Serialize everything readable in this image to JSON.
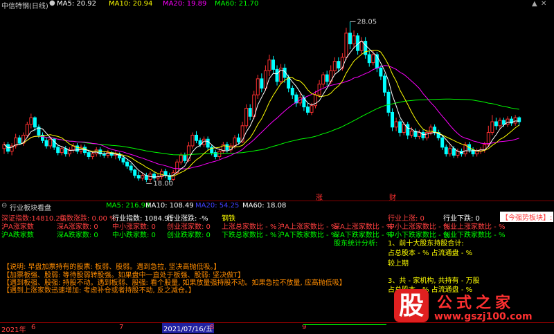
{
  "top": {
    "title": "中信特钢(日线)",
    "ma_items": [
      {
        "label": "MA5: 20.92",
        "color": "#ffffff"
      },
      {
        "label": "MA10: 20.94",
        "color": "#ffff00"
      },
      {
        "label": "MA20: 19.89",
        "color": "#ff00ff"
      },
      {
        "label": "MA60: 21.70",
        "color": "#00ff00"
      }
    ]
  },
  "chart_data": {
    "type": "candlestick",
    "high_label": "28.05",
    "low_label": "18.00",
    "markers": [
      {
        "text": "涨",
        "color": "#ff3030"
      },
      {
        "text": "财",
        "color": "#ff3030"
      }
    ],
    "candles": [
      [
        18.6,
        18.9,
        18.2,
        19.1
      ],
      [
        18.9,
        18.4,
        18.2,
        19.1
      ],
      [
        18.4,
        18.8,
        18.1,
        19.0
      ],
      [
        18.8,
        19.4,
        18.6,
        19.7
      ],
      [
        19.4,
        19.0,
        18.9,
        19.6
      ],
      [
        19.0,
        19.6,
        18.8,
        19.8
      ],
      [
        19.6,
        20.4,
        19.4,
        20.6
      ],
      [
        20.4,
        20.9,
        20.1,
        21.2
      ],
      [
        20.9,
        20.2,
        19.9,
        21.0
      ],
      [
        20.2,
        19.6,
        19.4,
        20.4
      ],
      [
        19.6,
        19.2,
        19.0,
        19.8
      ],
      [
        19.2,
        18.8,
        18.6,
        19.4
      ],
      [
        18.8,
        19.3,
        18.6,
        19.5
      ],
      [
        19.3,
        18.7,
        18.5,
        19.4
      ],
      [
        18.7,
        18.3,
        18.1,
        18.9
      ],
      [
        18.3,
        18.6,
        18.1,
        18.8
      ],
      [
        18.6,
        18.2,
        18.0,
        18.8
      ],
      [
        18.2,
        18.5,
        18.0,
        18.7
      ],
      [
        18.5,
        18.8,
        18.3,
        19.0
      ],
      [
        18.8,
        18.4,
        18.2,
        19.0
      ],
      [
        18.4,
        18.7,
        18.2,
        18.9
      ],
      [
        18.7,
        18.3,
        18.1,
        18.9
      ],
      [
        18.3,
        18.0,
        17.8,
        18.5
      ],
      [
        18.0,
        18.2,
        17.8,
        18.4
      ],
      [
        18.2,
        18.5,
        18.0,
        18.7
      ],
      [
        18.5,
        18.2,
        18.0,
        18.7
      ],
      [
        18.2,
        18.1,
        17.9,
        18.4
      ],
      [
        18.1,
        18.3,
        17.9,
        18.5
      ],
      [
        18.3,
        18.1,
        17.9,
        18.4
      ],
      [
        18.1,
        18.2,
        17.8,
        18.4
      ],
      [
        18.2,
        17.9,
        17.7,
        18.3
      ],
      [
        17.9,
        17.6,
        17.4,
        18.1
      ],
      [
        17.6,
        17.3,
        17.1,
        17.8
      ],
      [
        17.3,
        17.0,
        16.8,
        17.5
      ],
      [
        17.0,
        16.6,
        16.4,
        17.1
      ],
      [
        16.6,
        16.4,
        16.2,
        16.9
      ],
      [
        16.4,
        16.6,
        16.2,
        16.8
      ],
      [
        16.6,
        16.3,
        16.1,
        16.8
      ],
      [
        16.3,
        16.7,
        16.1,
        16.9
      ],
      [
        16.7,
        16.4,
        16.2,
        16.9
      ],
      [
        16.4,
        16.5,
        16.2,
        16.7
      ],
      [
        16.5,
        16.9,
        16.3,
        17.1
      ],
      [
        16.9,
        16.6,
        16.4,
        17.1
      ],
      [
        16.6,
        16.3,
        16.1,
        16.8
      ],
      [
        16.3,
        16.8,
        16.2,
        17.0
      ],
      [
        16.8,
        17.6,
        16.7,
        17.8
      ],
      [
        17.6,
        18.1,
        17.4,
        18.3
      ],
      [
        18.1,
        17.7,
        17.5,
        18.3
      ],
      [
        17.7,
        18.8,
        17.6,
        19.1
      ],
      [
        18.8,
        19.6,
        18.6,
        19.8
      ],
      [
        19.6,
        19.2,
        19.0,
        19.9
      ],
      [
        19.2,
        18.9,
        18.7,
        19.4
      ],
      [
        18.9,
        19.3,
        18.7,
        19.5
      ],
      [
        19.3,
        18.7,
        18.5,
        19.5
      ],
      [
        18.7,
        18.3,
        18.1,
        18.9
      ],
      [
        18.3,
        18.0,
        17.8,
        18.5
      ],
      [
        18.0,
        18.4,
        17.8,
        18.6
      ],
      [
        18.4,
        18.9,
        18.2,
        19.1
      ],
      [
        18.9,
        18.5,
        18.3,
        19.1
      ],
      [
        18.5,
        18.8,
        18.3,
        19.0
      ],
      [
        18.8,
        19.4,
        18.6,
        19.6
      ],
      [
        19.4,
        19.1,
        18.9,
        19.7
      ],
      [
        19.1,
        20.3,
        19.0,
        20.6
      ],
      [
        20.3,
        21.6,
        20.1,
        21.9
      ],
      [
        21.6,
        21.0,
        20.7,
        21.9
      ],
      [
        21.0,
        22.6,
        20.8,
        22.9
      ],
      [
        22.6,
        23.8,
        22.3,
        24.1
      ],
      [
        23.8,
        23.1,
        22.8,
        24.2
      ],
      [
        23.1,
        24.4,
        22.9,
        24.8
      ],
      [
        24.4,
        25.2,
        24.0,
        25.6
      ],
      [
        25.2,
        24.5,
        24.2,
        25.5
      ],
      [
        24.5,
        23.6,
        23.3,
        24.8
      ],
      [
        23.6,
        24.6,
        23.4,
        24.9
      ],
      [
        24.6,
        23.9,
        23.5,
        24.9
      ],
      [
        23.9,
        23.1,
        22.8,
        24.1
      ],
      [
        23.1,
        22.6,
        22.3,
        23.3
      ],
      [
        22.6,
        22.0,
        21.7,
        22.8
      ],
      [
        22.0,
        22.4,
        21.8,
        22.7
      ],
      [
        22.4,
        21.7,
        21.4,
        22.6
      ],
      [
        21.7,
        21.3,
        21.1,
        22.0
      ],
      [
        21.3,
        21.8,
        21.1,
        22.0
      ],
      [
        21.8,
        22.6,
        21.6,
        22.9
      ],
      [
        22.6,
        23.4,
        22.4,
        23.7
      ],
      [
        23.4,
        24.1,
        23.1,
        24.3
      ],
      [
        24.1,
        23.6,
        23.3,
        24.4
      ],
      [
        23.6,
        24.4,
        23.4,
        24.8
      ],
      [
        24.4,
        25.1,
        24.1,
        25.4
      ],
      [
        25.1,
        24.6,
        24.3,
        25.4
      ],
      [
        24.6,
        25.4,
        24.4,
        25.7
      ],
      [
        25.4,
        27.2,
        25.2,
        27.6
      ],
      [
        27.2,
        26.4,
        26.0,
        28.05
      ],
      [
        26.4,
        27.0,
        26.1,
        27.4
      ],
      [
        27.0,
        25.9,
        25.6,
        27.2
      ],
      [
        25.9,
        26.6,
        25.6,
        26.9
      ],
      [
        26.6,
        25.6,
        25.3,
        26.9
      ],
      [
        25.6,
        25.0,
        24.7,
        25.9
      ],
      [
        25.0,
        25.6,
        24.8,
        25.9
      ],
      [
        25.6,
        24.6,
        24.3,
        25.8
      ],
      [
        24.6,
        24.0,
        23.7,
        24.8
      ],
      [
        24.0,
        22.8,
        22.5,
        24.2
      ],
      [
        22.8,
        21.3,
        21.0,
        23.0
      ],
      [
        21.3,
        20.2,
        19.9,
        21.6
      ],
      [
        20.2,
        20.6,
        19.9,
        20.9
      ],
      [
        20.6,
        19.8,
        19.5,
        20.8
      ],
      [
        19.8,
        20.4,
        19.6,
        20.6
      ],
      [
        20.4,
        19.6,
        19.3,
        20.6
      ],
      [
        19.6,
        19.9,
        19.4,
        20.2
      ],
      [
        19.9,
        19.5,
        19.3,
        20.1
      ],
      [
        19.5,
        19.8,
        19.3,
        20.0
      ],
      [
        19.8,
        19.4,
        19.2,
        20.0
      ],
      [
        19.4,
        19.8,
        19.2,
        20.0
      ],
      [
        19.8,
        20.2,
        19.6,
        20.4
      ],
      [
        20.2,
        19.8,
        19.6,
        20.4
      ],
      [
        19.8,
        19.4,
        19.2,
        20.0
      ],
      [
        19.4,
        18.7,
        18.5,
        19.6
      ],
      [
        18.7,
        18.2,
        18.0,
        18.9
      ],
      [
        18.2,
        18.6,
        18.0,
        18.9
      ],
      [
        18.6,
        18.1,
        17.9,
        18.8
      ],
      [
        18.1,
        18.4,
        17.9,
        18.6
      ],
      [
        18.4,
        18.2,
        18.0,
        18.6
      ],
      [
        18.2,
        18.9,
        18.0,
        19.1
      ],
      [
        18.9,
        18.5,
        18.3,
        19.1
      ],
      [
        18.5,
        18.2,
        18.0,
        18.7
      ],
      [
        18.2,
        18.4,
        18.0,
        18.6
      ],
      [
        18.4,
        18.5,
        18.2,
        18.7
      ],
      [
        18.5,
        18.9,
        18.3,
        19.1
      ],
      [
        18.9,
        19.8,
        18.7,
        20.3
      ],
      [
        19.8,
        20.6,
        19.6,
        21.1
      ],
      [
        20.6,
        20.3,
        20.0,
        20.9
      ],
      [
        20.3,
        20.7,
        20.1,
        20.9
      ],
      [
        20.7,
        20.4,
        20.2,
        20.9
      ],
      [
        20.4,
        20.8,
        20.2,
        21.0
      ],
      [
        20.8,
        20.5,
        20.3,
        21.0
      ],
      [
        20.5,
        20.9,
        20.3,
        21.1
      ],
      [
        20.9,
        20.6,
        20.3,
        21.0
      ]
    ],
    "ma5_color": "#ffffff",
    "ma10_color": "#ffff00",
    "ma20_color": "#ff00ff",
    "ma60_color": "#00ff00",
    "up_color": "#ff3030",
    "down_color": "#00ffff"
  },
  "sub": {
    "title": "行业板块看盘",
    "ma_items": [
      {
        "label": "MA5: 216.98",
        "color": "#00ff00"
      },
      {
        "label": "MA10: 108.49",
        "color": "#ffffff"
      },
      {
        "label": "MA20: 54.25",
        "color": "#4040ff"
      },
      {
        "label": "MA60: 18.08",
        "color": "#ffffff"
      }
    ]
  },
  "panel": {
    "rows": [
      [
        {
          "text": "深证指数:14810.20",
          "color": "#ff4040"
        },
        {
          "text": "指数涨跌: 0.00 %",
          "color": "#ff4040"
        },
        {
          "text": "行业指数: 1084.91",
          "color": "#ffffff"
        },
        {
          "text": "行业涨跌: -%",
          "color": "#ffffff"
        },
        {
          "text": "钢铁",
          "color": "#ffff00"
        },
        {
          "text": "行业上涨: 0",
          "color": "#ff4040"
        },
        {
          "text": "行业下跌: 0",
          "color": "#ffffff"
        },
        {
          "text": "【今强势板块】:",
          "color": "#ff4040"
        }
      ],
      [
        {
          "text": "沪A涨家数",
          "color": "#ff4040"
        },
        {
          "text": "深A涨家数: 0",
          "color": "#ff4040"
        },
        {
          "text": "中小涨家数: 0",
          "color": "#ff4040"
        },
        {
          "text": "创业涨家数: 0",
          "color": "#ff4040"
        },
        {
          "text": "上涨总家数比 - %",
          "color": "#ff4040"
        },
        {
          "text": "沪A上涨家数比 - %",
          "color": "#ff4040"
        },
        {
          "text": "深A上涨家数比 - %",
          "color": "#ff4040"
        },
        {
          "text": "中小上涨家数比 - %",
          "color": "#ff4040"
        },
        {
          "text": "创业上涨家数比 - %",
          "color": "#ff4040"
        }
      ],
      [
        {
          "text": "沪A跌家数",
          "color": "#00ff00"
        },
        {
          "text": "深A跌家数: 0",
          "color": "#00ff00"
        },
        {
          "text": "中小跌家数: 0",
          "color": "#00ff00"
        },
        {
          "text": "创业跌家数: 0",
          "color": "#00ff00"
        },
        {
          "text": "下跌总家数比 - %",
          "color": "#00ff00"
        },
        {
          "text": "沪A下跌家数比 - %",
          "color": "#00ff00"
        },
        {
          "text": "深A下跌家数比 - %",
          "color": "#00ff00"
        },
        {
          "text": "中小下跌家数比 - %",
          "color": "#00ff00"
        },
        {
          "text": "创业下跌家数比 - %",
          "color": "#00ff00"
        }
      ]
    ],
    "shareholder_label": "股东统计分析:",
    "top10": [
      "1、前十大股东持股合计:",
      "占总股本 - %  占流通盘 - %",
      "较上期"
    ],
    "holders": [
      "3、共 - 家机构, 共持有 - 万股",
      "占总股本 - %  占流通盘 - %"
    ],
    "notes": [
      "【说明: 早盘加票持有的股票: 板弱、股弱。遇到急拉, 坚决高抛低吸。】",
      "【加票板强、股弱: 等待股弱转股强。如果盘中一直处于板强、股弱: 坚决做T】",
      "【遇到板强、股强: 持股不动。遇到板弱、股强: 看个股量, 如果放量强持股不动。如果急拉不放量, 应高抛低吸】",
      "【遇到上涨家数迅速增加: 考虑补仓或者持股不动, 反之减仓。】"
    ]
  },
  "bottom": {
    "labels": [
      "2021年",
      "6",
      "7",
      "2021/07/16/五",
      "8",
      "9"
    ]
  },
  "watermark": {
    "stamp": "股",
    "title": "公式之家",
    "url": "www.gszj100.com"
  }
}
